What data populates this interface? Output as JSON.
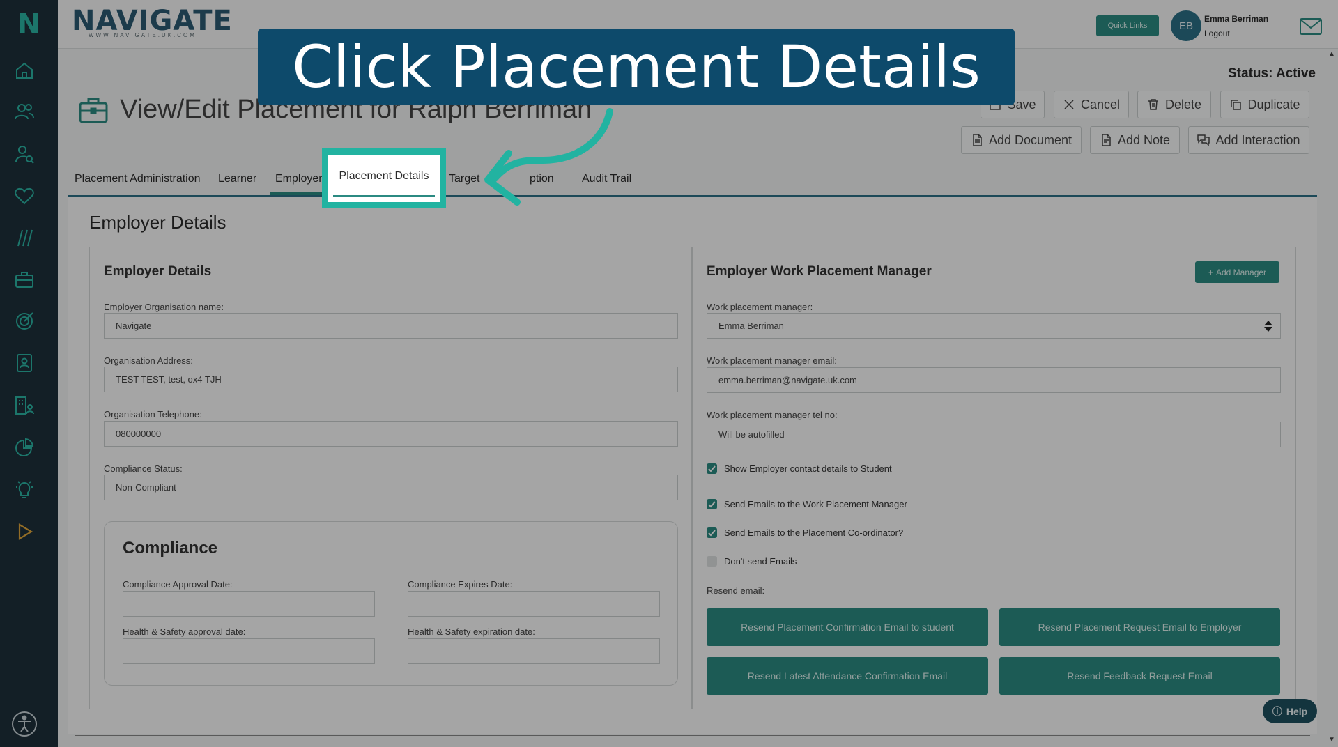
{
  "app": {
    "brand": "NAVIGATE",
    "brand_url": "WWW.NAVIGATE.UK.COM",
    "sidebar_logo": "N"
  },
  "topbar": {
    "quick_links": "Quick Links",
    "avatar_initials": "EB",
    "user_name": "Emma Berriman",
    "logout": "Logout"
  },
  "header": {
    "status": "Status: Active",
    "title": "View/Edit Placement for Ralph Berriman",
    "buttons": {
      "save": "Save",
      "cancel": "Cancel",
      "delete": "Delete",
      "duplicate": "Duplicate",
      "add_document": "Add Document",
      "add_note": "Add Note",
      "add_interaction": "Add Interaction"
    }
  },
  "tabs": {
    "placement_administration": "Placement Administration",
    "learner": "Learner",
    "employer": "Employer",
    "placement_details": "Placement Details",
    "target": "Target",
    "option": "ption",
    "audit_trail": "Audit Trail"
  },
  "main": {
    "section_title": "Employer Details",
    "employer_panel": {
      "title": "Employer Details",
      "org_name_label": "Employer Organisation name:",
      "org_name_value": "Navigate",
      "address_label": "Organisation Address:",
      "address_value": "TEST TEST, test, ox4 TJH",
      "telephone_label": "Organisation Telephone:",
      "telephone_value": "080000000",
      "compliance_status_label": "Compliance Status:",
      "compliance_status_value": "Non-Compliant",
      "compliance": {
        "title": "Compliance",
        "approval_label": "Compliance Approval Date:",
        "expires_label": "Compliance Expires Date:",
        "hs_approval_label": "Health & Safety approval date:",
        "hs_expiration_label": "Health & Safety expiration date:"
      }
    },
    "manager_panel": {
      "title": "Employer Work Placement Manager",
      "add_manager": "Add Manager",
      "manager_label": "Work placement manager:",
      "manager_value": "Emma Berriman",
      "email_label": "Work placement manager email:",
      "email_value": "emma.berriman@navigate.uk.com",
      "tel_label": "Work placement manager tel no:",
      "tel_value": "Will be autofilled",
      "checkboxes": [
        {
          "label": "Show Employer contact details to Student",
          "checked": true
        },
        {
          "label": "Send Emails to the Work Placement Manager",
          "checked": true
        },
        {
          "label": "Send Emails to the Placement Co-ordinator?",
          "checked": true
        },
        {
          "label": "Don't send Emails",
          "checked": false
        }
      ],
      "resend_label": "Resend email:",
      "resend_buttons": [
        "Resend Placement Confirmation Email to student",
        "Resend Placement Request Email to Employer",
        "Resend Latest Attendance Confirmation Email",
        "Resend Feedback Request Email"
      ]
    }
  },
  "help": "Help",
  "overlay": {
    "instruction": "Click Placement Details",
    "highlight_color": "#22b3a1",
    "banner_color": "#0d4a6b"
  },
  "colors": {
    "accent": "#2b8a82",
    "sidebar": "#1e2f3b"
  }
}
